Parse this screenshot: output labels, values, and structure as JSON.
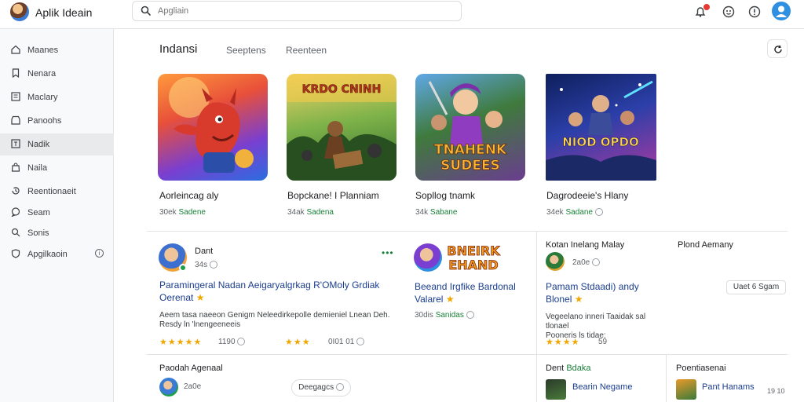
{
  "app": {
    "title": "Aplik Ideain"
  },
  "search": {
    "placeholder": "Apgliain"
  },
  "sidebar": {
    "items": [
      {
        "label": "Maanes"
      },
      {
        "label": "Nenara"
      },
      {
        "label": "Maclary"
      },
      {
        "label": "Panoohs"
      },
      {
        "label": "Nadik"
      },
      {
        "label": "Naila"
      },
      {
        "label": "Reentionaeit"
      },
      {
        "label": "Seam"
      },
      {
        "label": "Sonis"
      },
      {
        "label": "Apgilkaoin"
      }
    ],
    "active_index": 4
  },
  "section": {
    "title": "Indansi",
    "tabs": [
      "Seeptens",
      "Reenteen"
    ]
  },
  "featured": [
    {
      "title": "Aorleincag aly",
      "meta_prefix": "30ek",
      "meta_green": "Sadene"
    },
    {
      "title": "Bopckane! I Planniam",
      "meta_prefix": "34ak",
      "meta_green": "Sadena"
    },
    {
      "title": "Sopllog tnamk",
      "meta_prefix": "34k",
      "meta_green": "Sabane"
    },
    {
      "title": "Dagrodeeie's Hlany",
      "meta_prefix": "34ek",
      "meta_green": "Sadane"
    }
  ],
  "art_text": {
    "card2_banner": "KRDO CNINH",
    "card3_line1": "TNAHENK",
    "card3_line2": "SUDEES",
    "card4_banner": "NIOD OPDO",
    "review_banner_line1": "BNEIRK",
    "review_banner_line2": "EHAND"
  },
  "reviews": {
    "left": {
      "name": "Dant",
      "sub": "34s",
      "title_line1": "Paramingeral Nadan Aeigaryalgrkag R'OMoly Grdiak",
      "title_line2": "Oerenat",
      "body_line1": "Aeem tasa naeeon Genigm Neleedirkepolle demieniel Lnean Deh.",
      "body_line2": "Resdy ln 'lnengeeneeis",
      "stars": "★★★★★",
      "count": "1190"
    },
    "mid": {
      "title_line1": "Beeand Irgfike Bardonal",
      "title_line2": "Valarel",
      "meta_prefix": "30dis",
      "meta_green": "Sanidas",
      "stars": "★★★",
      "count": "0I01 01"
    },
    "right": {
      "heading": "Kotan Inelang Malay",
      "side_heading": "Plond Aemany",
      "sub": "2a0e",
      "title_line1": "Pamam Stdaadi) andy",
      "title_line2": "Blonel",
      "body_line1": "Vegeelano inneri Taaidak sal tlonael",
      "body_line2": "Pooneris ls tidae:",
      "stars": "★★★★",
      "count": "59",
      "chip": "Uaet 6 Sgam"
    }
  },
  "bottom": {
    "left_heading": "Paodah Agenaal",
    "left_sub": "2a0e",
    "chip": "Deegagcs",
    "mid_heading_prefix": "Dent",
    "mid_heading_green": "Bdaka",
    "mid_item": "Bearin Negame",
    "right_heading": "Poentiasenai",
    "right_item": "Pant Hanams",
    "right_count": "19 10"
  },
  "colors": {
    "accent_green": "#188038",
    "link_blue": "#1a3d8f",
    "star": "#f2a600",
    "notification": "#e53935",
    "avatar": "#2f8fe0"
  }
}
